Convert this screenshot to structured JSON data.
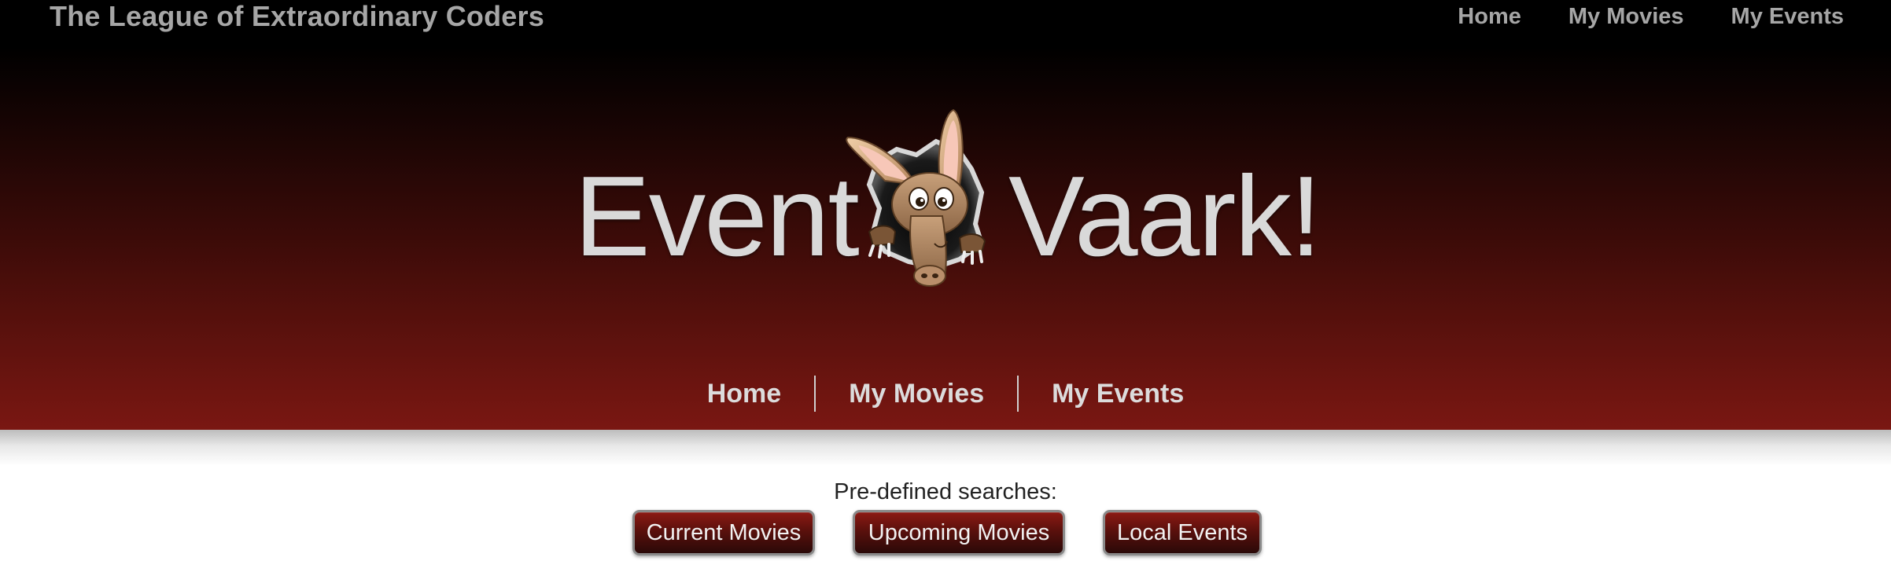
{
  "header": {
    "site_title": "The League of Extraordinary Coders",
    "nav": [
      "Home",
      "My Movies",
      "My Events"
    ]
  },
  "brand": {
    "left_word": "Event",
    "right_word": "Vaark!",
    "mascot_icon": "aardvark-mascot-icon"
  },
  "main_nav": [
    "Home",
    "My Movies",
    "My Events"
  ],
  "searches": {
    "label": "Pre-defined searches:",
    "buttons": [
      "Current Movies",
      "Upcoming Movies",
      "Local Events"
    ]
  },
  "colors": {
    "hero_top": "#000000",
    "hero_bottom": "#7a1712",
    "nav_text": "#a6a6a6",
    "button_red": "#8c1a14"
  }
}
